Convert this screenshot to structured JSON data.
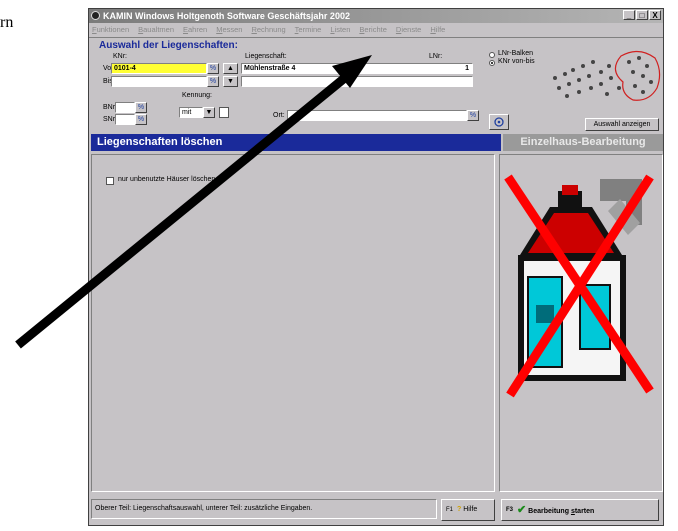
{
  "document": {
    "text_fragment": "rn"
  },
  "window": {
    "title": "KAMIN Windows   Holtgenoth Software   Geschäftsjahr 2002",
    "minimize_label": "_",
    "maximize_label": "□",
    "close_label": "X"
  },
  "menu": [
    {
      "prefix": "F",
      "rest": "unktionen"
    },
    {
      "prefix": "B",
      "rest": "aualtmen"
    },
    {
      "prefix": "E",
      "rest": "ahren"
    },
    {
      "prefix": "M",
      "rest": "essen"
    },
    {
      "prefix": "R",
      "rest": "echnung"
    },
    {
      "prefix": "T",
      "rest": "ermine"
    },
    {
      "prefix": "L",
      "rest": "isten"
    },
    {
      "prefix": "B",
      "rest": "erichte"
    },
    {
      "prefix": "D",
      "rest": "ienste"
    },
    {
      "prefix": "H",
      "rest": "ilfe"
    }
  ],
  "selection": {
    "heading": "Auswahl der Liegenschaften:",
    "knr_header": "KNr:",
    "liegenschaft_header": "Liegenschaft:",
    "lnr_header": "LNr:",
    "von_label": "Von:",
    "bis_label": "Bis:",
    "von_value": "0101-4",
    "bis_value": "",
    "liegenschaft_value": "Mühlenstraße 4",
    "lnr_value": "1",
    "bnr_label": "BNr.:",
    "snr_label": "SNr.:",
    "kennung_label": "Kennung:",
    "kennung_value": "mit",
    "ort_label": "Ort:",
    "ort_value": "",
    "lookup_glyph": "%",
    "up_glyph": "▲",
    "down_glyph": "▼",
    "dropdown_glyph": "▼",
    "radio_options": [
      "LNr-Balken",
      "KNr von-bis"
    ],
    "radio_selected": "KNr von-bis",
    "show_selection_button": "Auswahl anzeigen"
  },
  "tabs": {
    "active": "Liegenschaften löschen",
    "inactive": "Einzelhaus-Bearbeitung"
  },
  "panel": {
    "checkbox_label": "nur unbenutzte Häuser löschen",
    "checkbox_checked": false
  },
  "statusbar": {
    "text": "Oberer Teil: Liegenschaftsauswahl, unterer Teil: zusätzliche Eingaben."
  },
  "buttons": {
    "help_key": "F1",
    "help_label": "Hilfe",
    "start_key": "F3",
    "start_label_prefix": "Bearbeitung ",
    "start_label_underlined": "s",
    "start_label_suffix": "tarten"
  },
  "colors": {
    "accent_blue": "#1a2a9a",
    "highlight_yellow": "#ffff33",
    "delete_red": "#ff0000",
    "window_gray": "#c6c3c6"
  },
  "icons": {
    "map_dots": "map-dots-icon",
    "house_delete": "house-delete-icon",
    "arrow_annotation": "arrow-annotation"
  }
}
